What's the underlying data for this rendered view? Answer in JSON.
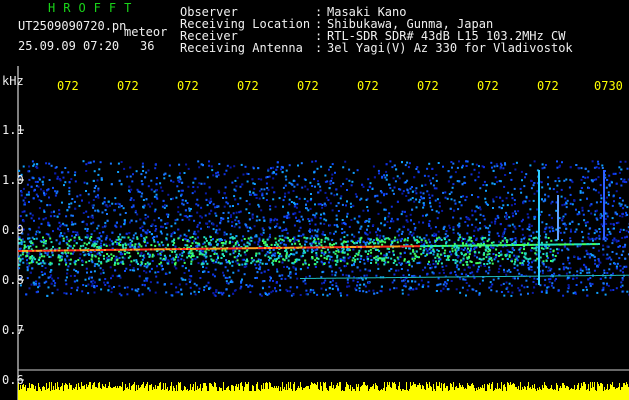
{
  "header": {
    "brand": "HROFFT",
    "filename": "UT2509090720.pn",
    "tag": "meteor",
    "timestamp": "25.09.09 07:20",
    "count": "36",
    "fields": [
      {
        "label": "Observer",
        "sep": ":",
        "value": "Masaki Kano"
      },
      {
        "label": "Receiving Location",
        "sep": ":",
        "value": "Shibukawa, Gunma, Japan"
      },
      {
        "label": "Receiver",
        "sep": ":",
        "value": "RTL-SDR SDR# 43dB L15 103.2MHz CW"
      },
      {
        "label": "Receiving Antenna",
        "sep": ":",
        "value": "3el Yagi(V) Az 330 for Vladivostok"
      }
    ]
  },
  "axis": {
    "unit": "kHz",
    "y_ticks": [
      "1.1",
      "1.0",
      "0.9",
      "0.8",
      "0.7",
      "0.6"
    ],
    "time_ticks": [
      "072",
      "072",
      "072",
      "072",
      "072",
      "072",
      "072",
      "072",
      "072",
      "0730"
    ]
  },
  "colors": {
    "background": "#000000",
    "text": "#f0f0f0",
    "time_labels": "#ffff00",
    "brand": "#19d419",
    "signal_band": "#ff4020",
    "noise": "#1040ff",
    "level_bars": "#ffff00"
  }
}
